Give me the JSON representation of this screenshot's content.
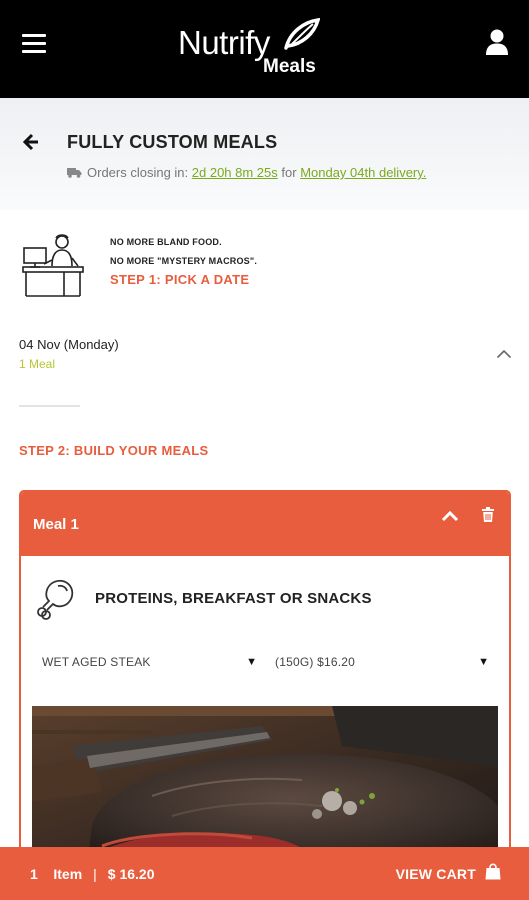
{
  "app": {
    "logo_main": "Nutrify",
    "logo_sub": "Meals"
  },
  "header": {
    "title": "FULLY CUSTOM MEALS",
    "closing_prefix": "Orders closing in: ",
    "closing_countdown": "2d 20h 8m 25s",
    "closing_mid": " for ",
    "delivery_link": "Monday 04th delivery."
  },
  "intro": {
    "line1": "NO MORE BLAND FOOD.",
    "line2": "NO MORE \"MYSTERY MACROS\".",
    "step1": "STEP 1: PICK A DATE"
  },
  "date": {
    "label": "04 Nov (Monday)",
    "meals": "1 Meal"
  },
  "step2": "STEP 2: BUILD YOUR MEALS",
  "meal": {
    "title": "Meal 1",
    "category": "PROTEINS, BREAKFAST OR SNACKS",
    "product_selected": "WET AGED STEAK",
    "size_selected": "(150G) $16.20"
  },
  "cart": {
    "count": "1",
    "item_label": "Item",
    "separator": "|",
    "total": "$ 16.20",
    "view_cart": "VIEW CART"
  },
  "icons": {
    "menu": "hamburger-menu-icon",
    "user": "user-icon",
    "back": "arrow-left-icon",
    "truck": "truck-icon",
    "chevron_up": "chevron-up-icon",
    "trash": "trash-icon",
    "drumstick": "drumstick-icon",
    "bag": "shopping-bag-icon"
  },
  "colors": {
    "accent": "#e85d3d",
    "link_green": "#7aaa1e",
    "meal_count": "#b7c533",
    "appbar": "#000000"
  }
}
